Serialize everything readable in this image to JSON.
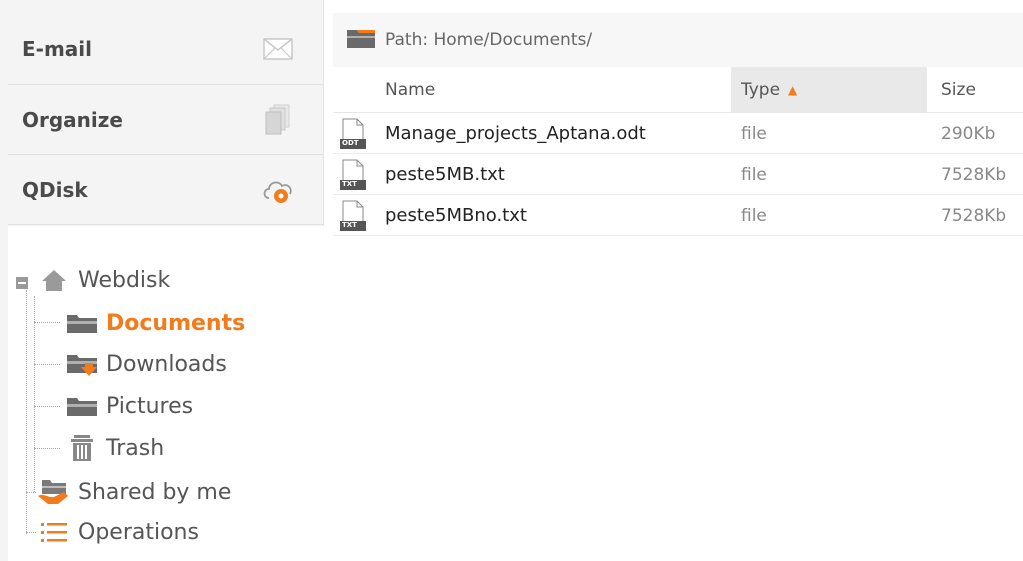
{
  "sidebar": {
    "accordion": [
      {
        "label": "E-mail",
        "icon": "envelope-icon"
      },
      {
        "label": "Organize",
        "icon": "pages-icon"
      },
      {
        "label": "QDisk",
        "icon": "cloud-icon"
      }
    ],
    "tree": {
      "root": {
        "label": "Webdisk",
        "icon": "home-icon"
      },
      "children": [
        {
          "label": "Documents",
          "icon": "folder-icon",
          "active": true
        },
        {
          "label": "Downloads",
          "icon": "folder-download-icon"
        },
        {
          "label": "Pictures",
          "icon": "folder-icon"
        },
        {
          "label": "Trash",
          "icon": "trash-icon"
        }
      ],
      "extra": [
        {
          "label": "Shared by me",
          "icon": "folder-shared-icon"
        },
        {
          "label": "Operations",
          "icon": "list-icon"
        }
      ]
    }
  },
  "main": {
    "path": "Path: Home/Documents/",
    "columns": {
      "name": "Name",
      "type": "Type",
      "size": "Size"
    },
    "rows": [
      {
        "name": "Manage_projects_Aptana.odt",
        "type": "file",
        "size": "290Kb",
        "badge": "ODT"
      },
      {
        "name": "peste5MB.txt",
        "type": "file",
        "size": "7528Kb",
        "badge": "TXT"
      },
      {
        "name": "peste5MBno.txt",
        "type": "file",
        "size": "7528Kb",
        "badge": "TXT"
      }
    ]
  },
  "colors": {
    "accent": "#f27b1c",
    "icon_gray": "#8a8a8a"
  }
}
